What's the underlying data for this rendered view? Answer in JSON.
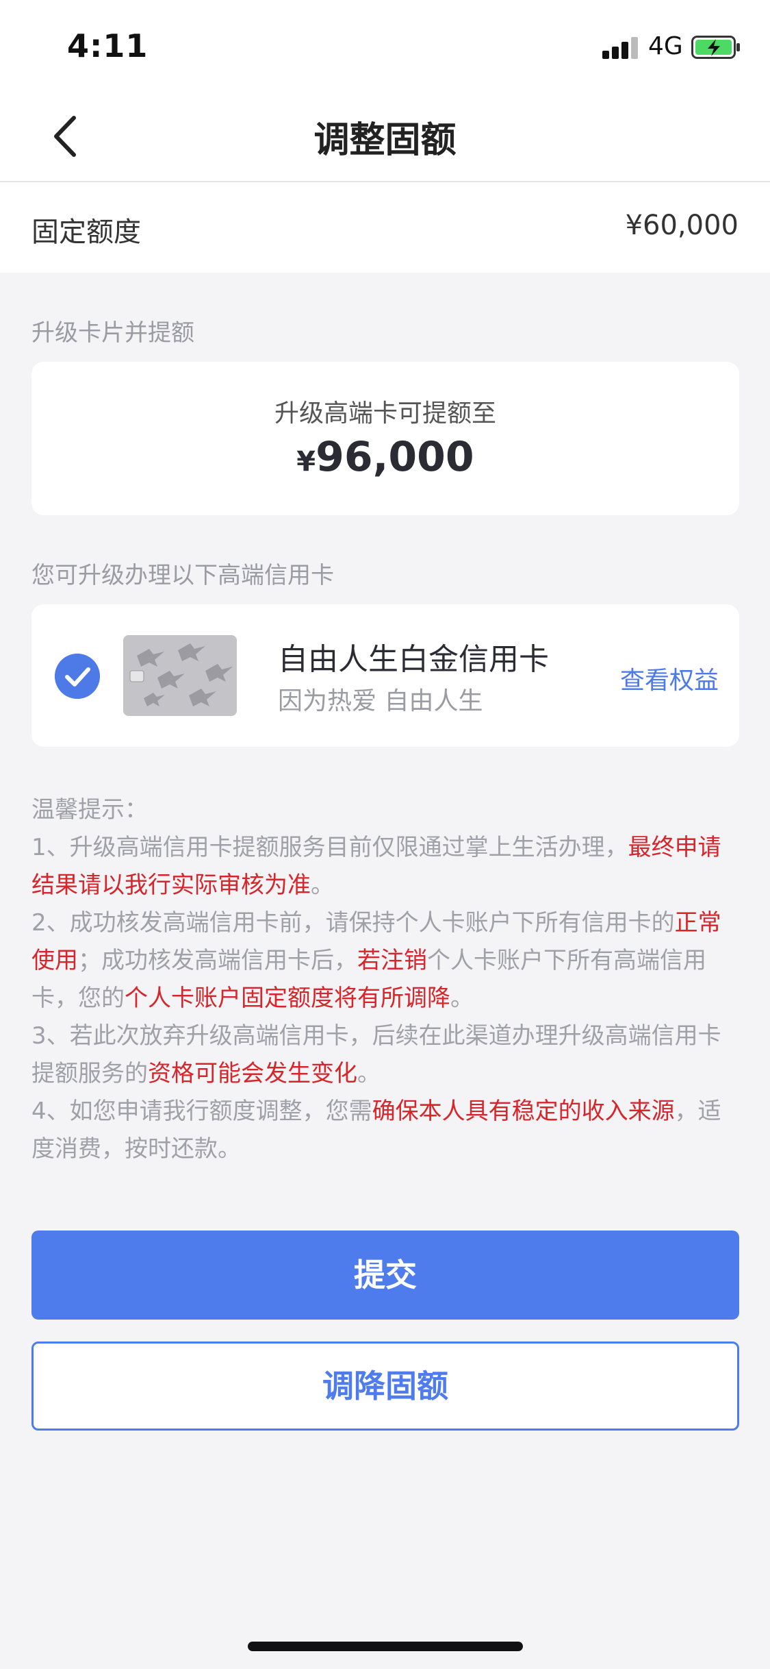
{
  "status_bar": {
    "time": "4:11",
    "network": "4G"
  },
  "nav": {
    "title": "调整固额"
  },
  "quota": {
    "label": "固定额度",
    "value": "¥60,000"
  },
  "upgrade_section": {
    "label": "升级卡片并提额",
    "caption": "升级高端卡可提额至",
    "currency": "¥",
    "amount": "96,000"
  },
  "cards_section": {
    "label": "您可升级办理以下高端信用卡"
  },
  "card": {
    "name": "自由人生白金信用卡",
    "slogan": "因为热爱 自由人生",
    "benefits_link": "查看权益",
    "selected": true
  },
  "tips": {
    "title": "温馨提示：",
    "t1_a": "1、升级高端信用卡提额服务目前仅限通过掌上生活办理，",
    "t1_b": "最终申请结果请以我行实际审核为准",
    "t1_c": "。",
    "t2_a": "2、成功核发高端信用卡前，请保持个人卡账户下所有信用卡的",
    "t2_b": "正常使用",
    "t2_c": "；成功核发高端信用卡后，",
    "t2_d": "若注销",
    "t2_e": "个人卡账户下所有高端信用卡，您的",
    "t2_f": "个人卡账户固定额度将有所调降",
    "t2_g": "。",
    "t3_a": "3、若此次放弃升级高端信用卡，后续在此渠道办理升级高端信用卡提额服务的",
    "t3_b": "资格可能会发生变化",
    "t3_c": "。",
    "t4_a": "4、如您申请我行额度调整，您需",
    "t4_b": "确保本人具有稳定的收入来源",
    "t4_c": "，适度消费，按时还款。"
  },
  "buttons": {
    "submit": "提交",
    "lower_quota": "调降固额"
  },
  "colors": {
    "accent": "#4f7cec",
    "warning_red": "#d7262b",
    "background": "#f4f4f6"
  }
}
